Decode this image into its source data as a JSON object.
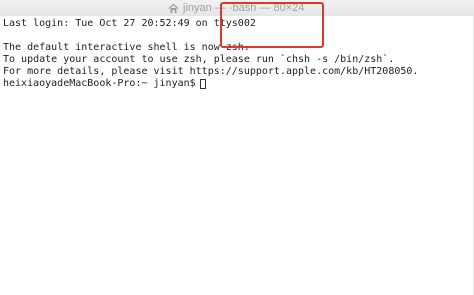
{
  "window": {
    "title": "jinyan — -bash — 80×24",
    "title_icon": "home-icon"
  },
  "terminal": {
    "lines": [
      "Last login: Tue Oct 27 20:52:49 on ttys002",
      "",
      "The default interactive shell is now zsh.",
      "To update your account to use zsh, please run `chsh -s /bin/zsh`.",
      "For more details, please visit https://support.apple.com/kb/HT208050."
    ],
    "prompt": "heixiaoyadeMacBook-Pro:~ jinyan$"
  },
  "annotation": {
    "color": "#d83a2a"
  }
}
